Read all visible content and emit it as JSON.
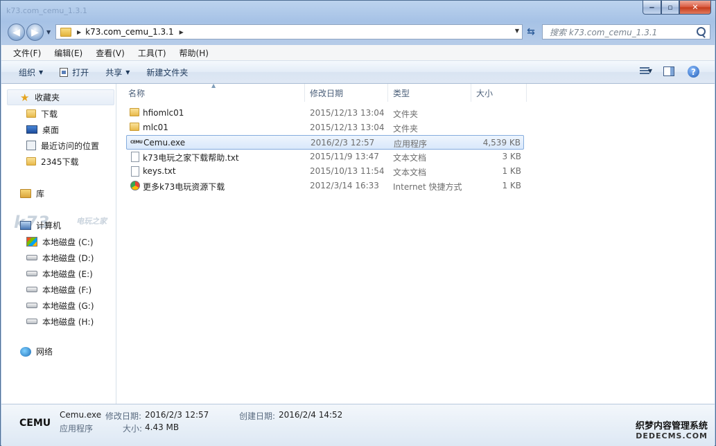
{
  "window": {
    "title": "k73.com_cemu_1.3.1"
  },
  "caption": {
    "minimize": "‒",
    "maximize": "▫",
    "close": "✕"
  },
  "address": {
    "path": "k73.com_cemu_1.3.1"
  },
  "search": {
    "placeholder": "搜索 k73.com_cemu_1.3.1"
  },
  "menu": {
    "items": [
      "文件(F)",
      "编辑(E)",
      "查看(V)",
      "工具(T)",
      "帮助(H)"
    ]
  },
  "toolbar": {
    "organize": "组织",
    "open": "打开",
    "share": "共享",
    "new_folder": "新建文件夹"
  },
  "nav": {
    "favorites_label": "收藏夹",
    "favorites": [
      "下载",
      "桌面",
      "最近访问的位置",
      "2345下载"
    ],
    "libraries_label": "库",
    "computer_label": "计算机",
    "drives": [
      "本地磁盘 (C:)",
      "本地磁盘 (D:)",
      "本地磁盘 (E:)",
      "本地磁盘 (F:)",
      "本地磁盘 (G:)",
      "本地磁盘 (H:)"
    ],
    "network_label": "网络"
  },
  "watermark": {
    "k73": "k73",
    "k73_sub": "电玩之家",
    "dede_line1": "织梦内容管理系统",
    "dede_line2": "DEDECMS.COM"
  },
  "columns": {
    "name": "名称",
    "date": "修改日期",
    "type": "类型",
    "size": "大小"
  },
  "files": [
    {
      "name": "hfiomlc01",
      "date": "2015/12/13 13:04",
      "type": "文件夹",
      "size": "",
      "icon": "folder-icon"
    },
    {
      "name": "mlc01",
      "date": "2015/12/13 13:04",
      "type": "文件夹",
      "size": "",
      "icon": "folder-icon"
    },
    {
      "name": "Cemu.exe",
      "date": "2016/2/3 12:57",
      "type": "应用程序",
      "size": "4,539 KB",
      "icon": "cemu-exe-icon",
      "selected": true
    },
    {
      "name": "k73电玩之家下载帮助.txt",
      "date": "2015/11/9 13:47",
      "type": "文本文档",
      "size": "3 KB",
      "icon": "text-file-icon"
    },
    {
      "name": "keys.txt",
      "date": "2015/10/13 11:54",
      "type": "文本文档",
      "size": "1 KB",
      "icon": "text-file-icon"
    },
    {
      "name": "更多k73电玩资源下载",
      "date": "2012/3/14 16:33",
      "type": "Internet 快捷方式",
      "size": "1 KB",
      "icon": "internet-shortcut-icon"
    }
  ],
  "details": {
    "logo": "CEMU",
    "file_name": "Cemu.exe",
    "modified_label": "修改日期:",
    "modified_value": "2016/2/3 12:57",
    "created_label": "创建日期:",
    "created_value": "2016/2/4 14:52",
    "type_value": "应用程序",
    "size_label": "大小:",
    "size_value": "4.43 MB"
  },
  "colors": {
    "selection": "#d9e8fb",
    "selection_border": "#84acdd",
    "frame": "#a6c2e6"
  }
}
